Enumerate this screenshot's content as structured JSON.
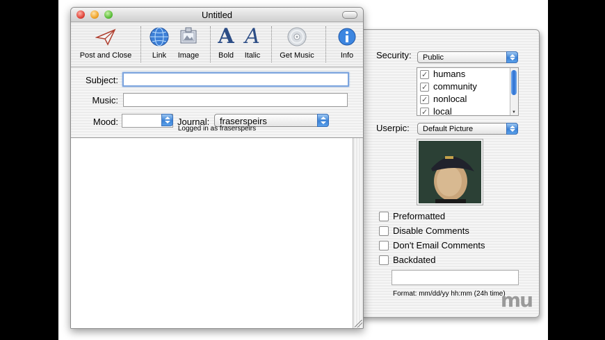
{
  "window": {
    "title": "Untitled"
  },
  "toolbar": {
    "post_and_close": "Post and Close",
    "link": "Link",
    "image": "Image",
    "bold": "Bold",
    "italic": "Italic",
    "get_music": "Get Music",
    "info": "Info"
  },
  "form": {
    "subject_label": "Subject:",
    "subject_value": "",
    "music_label": "Music:",
    "music_value": "",
    "mood_label": "Mood:",
    "mood_value": "",
    "journal_label": "Journal:",
    "journal_value": "fraserspeirs",
    "logged_in": "Logged in as fraserspeirs"
  },
  "drawer": {
    "security_label": "Security:",
    "security_value": "Public",
    "groups": [
      {
        "label": "humans",
        "checked": true
      },
      {
        "label": "community",
        "checked": true
      },
      {
        "label": "nonlocal",
        "checked": true
      },
      {
        "label": "local",
        "checked": true
      }
    ],
    "userpic_label": "Userpic:",
    "userpic_value": "Default Picture",
    "options": {
      "preformatted": "Preformatted",
      "disable_comments": "Disable Comments",
      "dont_email_comments": "Don't Email Comments",
      "backdated": "Backdated"
    },
    "date_value": "",
    "format_hint": "Format: mm/dd/yy hh:mm (24h time)",
    "watermark": "mu"
  },
  "colors": {
    "accent": "#3b82d6",
    "icon_blue": "#2c4d86"
  }
}
